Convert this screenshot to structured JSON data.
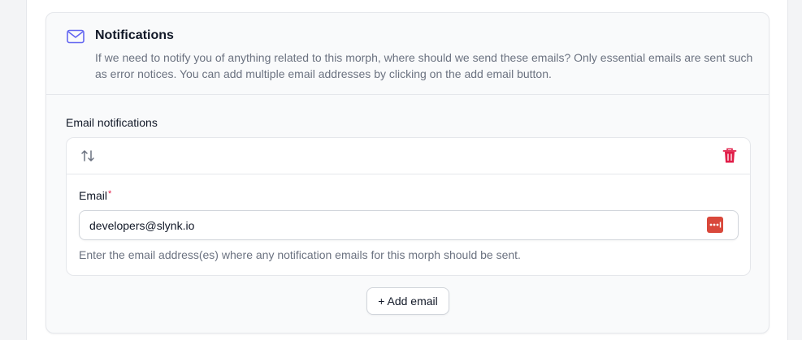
{
  "section": {
    "title": "Notifications",
    "description": "If we need to notify you of anything related to this morph, where should we send these emails? Only essential emails are sent such as error notices. You can add multiple email addresses by clicking on the add email button.",
    "icon": "envelope-icon",
    "accent_color": "#6366f1"
  },
  "field": {
    "label": "Email notifications"
  },
  "repeater": {
    "reorder_icon": "arrows-up-down-icon",
    "delete_icon": "trash-icon",
    "delete_color": "#e11d48",
    "items": [
      {
        "email_label": "Email",
        "required_marker": "*",
        "email_value": "developers@slynk.io",
        "helper_text": "Enter the email address(es) where any notification emails for this morph should be sent."
      }
    ]
  },
  "actions": {
    "add_email_label": "+ Add email"
  }
}
